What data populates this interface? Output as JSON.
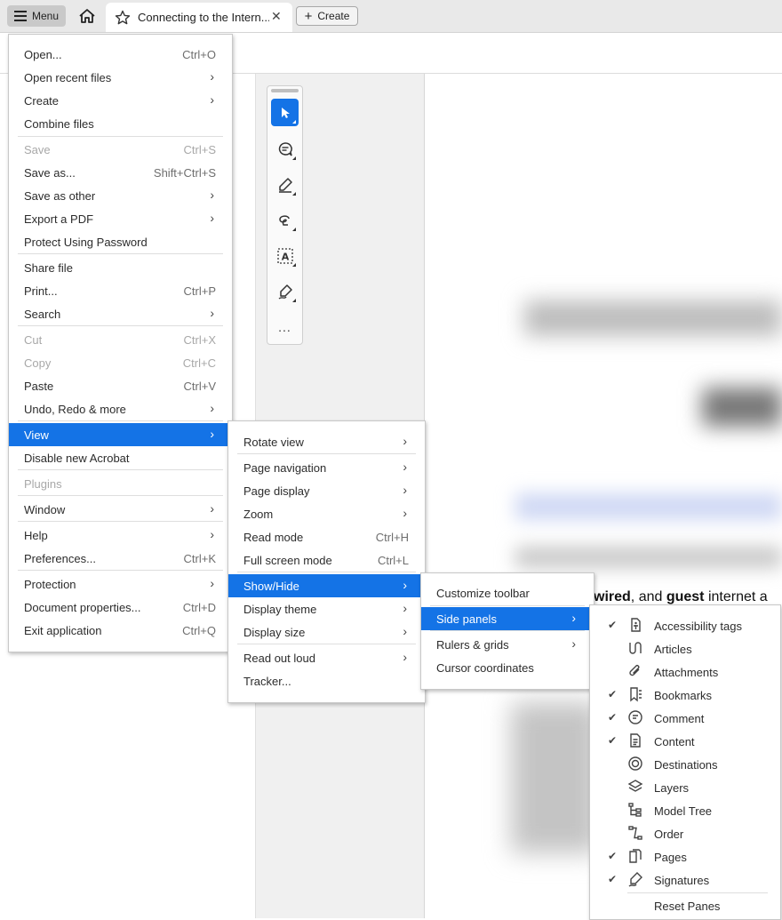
{
  "tabbar": {
    "menu_label": "Menu",
    "tab_title": "Connecting to the Intern...",
    "create_label": "Create"
  },
  "document": {
    "visible_text_pre": "wired",
    "visible_text_mid": ", and ",
    "visible_text_bold2": "guest",
    "visible_text_post": " internet a"
  },
  "main_menu": {
    "items": [
      {
        "label": "Open...",
        "shortcut": "Ctrl+O"
      },
      {
        "label": "Open recent files",
        "submenu": true
      },
      {
        "label": "Create",
        "submenu": true
      },
      {
        "label": "Combine files"
      },
      {
        "label": "Save",
        "shortcut": "Ctrl+S",
        "disabled": true
      },
      {
        "label": "Save as...",
        "shortcut": "Shift+Ctrl+S"
      },
      {
        "label": "Save as other",
        "submenu": true
      },
      {
        "label": "Export a PDF",
        "submenu": true
      },
      {
        "label": "Protect Using Password"
      },
      {
        "label": "Share file"
      },
      {
        "label": "Print...",
        "shortcut": "Ctrl+P"
      },
      {
        "label": "Search",
        "submenu": true
      },
      {
        "label": "Cut",
        "shortcut": "Ctrl+X",
        "disabled": true
      },
      {
        "label": "Copy",
        "shortcut": "Ctrl+C",
        "disabled": true
      },
      {
        "label": "Paste",
        "shortcut": "Ctrl+V"
      },
      {
        "label": "Undo, Redo & more",
        "submenu": true
      },
      {
        "label": "View",
        "submenu": true,
        "highlighted": true
      },
      {
        "label": "Disable new Acrobat"
      },
      {
        "label": "Plugins",
        "disabled": true
      },
      {
        "label": "Window",
        "submenu": true
      },
      {
        "label": "Help",
        "submenu": true
      },
      {
        "label": "Preferences...",
        "shortcut": "Ctrl+K"
      },
      {
        "label": "Protection",
        "submenu": true
      },
      {
        "label": "Document properties...",
        "shortcut": "Ctrl+D"
      },
      {
        "label": "Exit application",
        "shortcut": "Ctrl+Q"
      }
    ]
  },
  "view_menu": {
    "items": [
      {
        "label": "Rotate view",
        "submenu": true
      },
      {
        "label": "Page navigation",
        "submenu": true
      },
      {
        "label": "Page display",
        "submenu": true
      },
      {
        "label": "Zoom",
        "submenu": true
      },
      {
        "label": "Read mode",
        "shortcut": "Ctrl+H"
      },
      {
        "label": "Full screen mode",
        "shortcut": "Ctrl+L"
      },
      {
        "label": "Show/Hide",
        "submenu": true,
        "highlighted": true
      },
      {
        "label": "Display theme",
        "submenu": true
      },
      {
        "label": "Display size",
        "submenu": true
      },
      {
        "label": "Read out loud",
        "submenu": true
      },
      {
        "label": "Tracker..."
      }
    ]
  },
  "showhide_menu": {
    "items": [
      {
        "label": "Customize toolbar"
      },
      {
        "label": "Side panels",
        "submenu": true,
        "highlighted": true
      },
      {
        "label": "Rulers & grids",
        "submenu": true
      },
      {
        "label": "Cursor coordinates"
      }
    ]
  },
  "sidepanels_menu": {
    "items": [
      {
        "label": "Accessibility tags",
        "checked": true,
        "icon": "accessibility-tags-icon"
      },
      {
        "label": "Articles",
        "checked": false,
        "icon": "articles-icon"
      },
      {
        "label": "Attachments",
        "checked": false,
        "icon": "paperclip-icon"
      },
      {
        "label": "Bookmarks",
        "checked": true,
        "icon": "bookmark-icon"
      },
      {
        "label": "Comment",
        "checked": true,
        "icon": "comment-icon"
      },
      {
        "label": "Content",
        "checked": true,
        "icon": "content-icon"
      },
      {
        "label": "Destinations",
        "checked": false,
        "icon": "destinations-icon"
      },
      {
        "label": "Layers",
        "checked": false,
        "icon": "layers-icon"
      },
      {
        "label": "Model Tree",
        "checked": false,
        "icon": "model-tree-icon"
      },
      {
        "label": "Order",
        "checked": false,
        "icon": "order-icon"
      },
      {
        "label": "Pages",
        "checked": true,
        "icon": "pages-icon"
      },
      {
        "label": "Signatures",
        "checked": true,
        "icon": "signatures-icon"
      },
      {
        "label": "Reset Panes"
      }
    ]
  },
  "toolbar_tools": {
    "more_label": "..."
  }
}
